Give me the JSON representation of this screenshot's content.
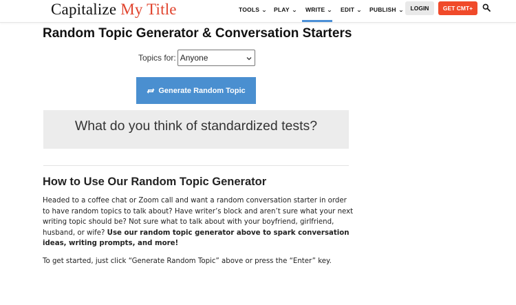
{
  "header": {
    "logo_main": "Capitalize",
    "logo_accent": "My Title",
    "nav": [
      {
        "label": "TOOLS"
      },
      {
        "label": "PLAY"
      },
      {
        "label": "WRITE"
      },
      {
        "label": "EDIT"
      },
      {
        "label": "PUBLISH"
      }
    ],
    "active_nav": "WRITE",
    "login_label": "LOGIN",
    "cta_label": "GET CMT+"
  },
  "colors": {
    "accent_red": "#f04a2a",
    "button_blue": "#4a8fd0",
    "topic_box_bg": "#ececec",
    "active_underline": "#4a8fd6"
  },
  "main": {
    "title": "Random Topic Generator & Conversation Starters",
    "topics_label": "Topics for:",
    "topics_selected": "Anyone",
    "generate_label": "Generate Random Topic",
    "topic_text": "What do you think of standardized tests?",
    "how_heading": "How to Use Our Random Topic Generator",
    "para_text": "Headed to a coffee chat or Zoom call and want a random conversation starter in order to have random topics to talk about? Have writer’s block and aren’t sure what your next writing topic should be? Not sure what to talk about with your boyfriend, girlfriend, husband, or wife?",
    "para_bold": "Use our random topic generator above to spark conversation ideas, writing prompts, and more!",
    "para2": "To get started, just click “Generate Random Topic” above or press the “Enter” key."
  }
}
